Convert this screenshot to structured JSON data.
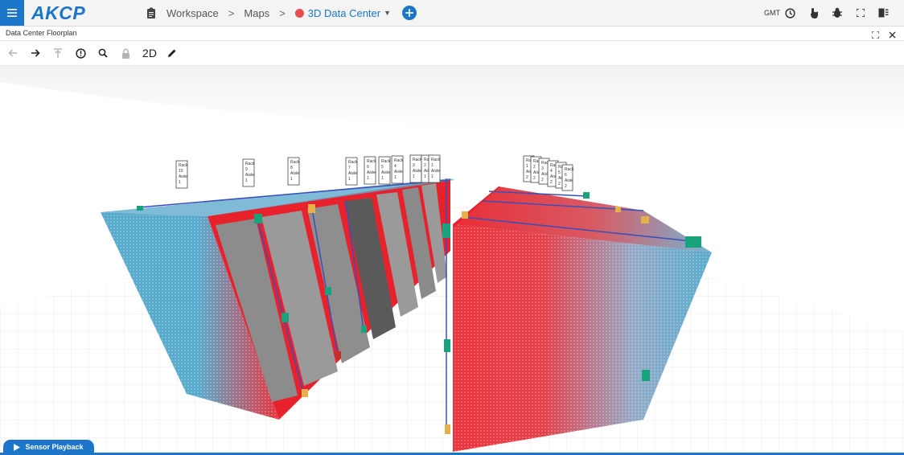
{
  "app": {
    "logo": "AKCP"
  },
  "breadcrumb": {
    "workspace": "Workspace",
    "maps": "Maps",
    "current_map": "3D Data Center",
    "current_map_color": "#e84d4d",
    "add_icon": "plus-icon"
  },
  "header_tools": {
    "timezone": "GMT",
    "icons": [
      "clock-icon",
      "touch-icon",
      "bug-icon",
      "fullscreen-icon",
      "door-icon"
    ]
  },
  "panel": {
    "title": "Data Center Floorplan",
    "controls": [
      "expand-icon",
      "close-icon"
    ]
  },
  "toolbar": {
    "icons": [
      "back-arrow-icon",
      "forward-arrow-icon",
      "move-top-icon",
      "alert-icon",
      "search-icon",
      "lock-icon"
    ],
    "mode_label": "2D",
    "edit_icon": "pencil-icon"
  },
  "scene": {
    "left_row_labels": [
      "Rack 10 Aisle 1",
      "Rack 9 Aisle 1",
      "Rack 8 Aisle 1",
      "Rack 7 Aisle 1",
      "Rack 6 Aisle 1",
      "Rack 5 Aisle 1",
      "Rack 4 Aisle 1",
      "Rack 3 Aisle 1",
      "Rack 2 Aisle 1",
      "Rack 1 Aisle 1"
    ],
    "right_row_labels": [
      "Rack 1 Aisle 2",
      "Rack 2 Aisle 2",
      "Rack 3 Aisle 2",
      "Rack 4 Aisle 2",
      "Rack 5 Aisle 2",
      "Rack 6 Aisle 2"
    ],
    "colors": {
      "hot": "#e8222c",
      "cool": "#4aa3c8",
      "sensor_green": "#19a37d",
      "sensor_yellow": "#e6b04a",
      "cable": "#3a4fb8"
    }
  },
  "footer": {
    "playback_label": "Sensor Playback",
    "playback_icon": "play-icon"
  }
}
